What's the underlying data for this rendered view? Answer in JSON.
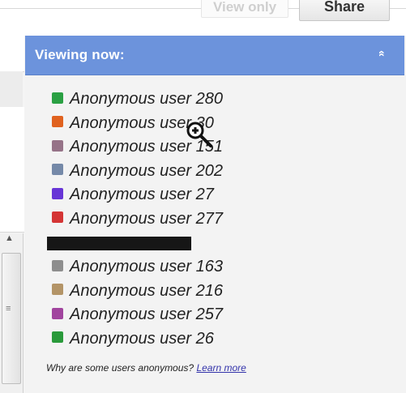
{
  "top_bar": {
    "view_only_label": "View only",
    "share_label": "Share"
  },
  "left_pane": {
    "scroll_up_icon": "▲",
    "scroll_grip_icon": "≡"
  },
  "panel": {
    "title": "Viewing now:",
    "collapse_icon": "«",
    "header_color": "#6c93dc"
  },
  "users": [
    {
      "name": "Anonymous user 280",
      "color": "#2aa043"
    },
    {
      "name": "Anonymous user 30",
      "color": "#e0621f"
    },
    {
      "name": "Anonymous user 151",
      "color": "#967388"
    },
    {
      "name": "Anonymous user 202",
      "color": "#7589a8"
    },
    {
      "name": "Anonymous user 27",
      "color": "#6735d6"
    },
    {
      "name": "Anonymous user 277",
      "color": "#d43535"
    },
    {
      "name": "",
      "color": "",
      "redacted": true
    },
    {
      "name": "Anonymous user 163",
      "color": "#8e8e8e"
    },
    {
      "name": "Anonymous user 216",
      "color": "#b39467"
    },
    {
      "name": "Anonymous user 257",
      "color": "#a1449e"
    },
    {
      "name": "Anonymous user 26",
      "color": "#2a9a3b"
    }
  ],
  "footer": {
    "question": "Why are some users anonymous?",
    "link_label": "Learn more"
  }
}
